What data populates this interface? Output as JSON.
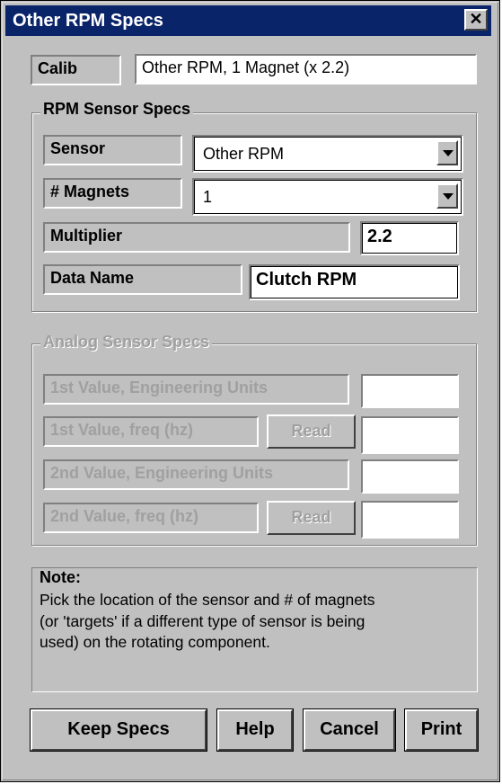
{
  "window": {
    "title": "Other RPM Specs",
    "close_symbol": "✕"
  },
  "calib": {
    "label": "Calib",
    "value": "Other RPM, 1 Magnet (x 2.2)"
  },
  "rpm_group": {
    "title": "RPM Sensor Specs",
    "sensor_label": "Sensor",
    "sensor_value": "Other RPM",
    "magnets_label": "# Magnets",
    "magnets_value": "1",
    "multiplier_label": "Multiplier",
    "multiplier_value": "2.2",
    "data_name_label": "Data Name",
    "data_name_value": "Clutch RPM"
  },
  "analog_group": {
    "title": "Analog Sensor Specs",
    "first_eng_label": "1st Value, Engineering Units",
    "first_freq_label": "1st Value, freq (hz)",
    "second_eng_label": "2nd Value, Engineering Units",
    "second_freq_label": "2nd Value, freq (hz)",
    "read_label": "Read",
    "first_eng_value": "",
    "first_freq_value": "",
    "second_eng_value": "",
    "second_freq_value": ""
  },
  "note": {
    "title": "Note:",
    "line1": "Pick the location of the sensor and # of magnets",
    "line2": "(or 'targets' if a different type of sensor is being",
    "line3": "used) on the rotating component."
  },
  "buttons": {
    "keep": "Keep Specs",
    "help": "Help",
    "cancel": "Cancel",
    "print": "Print"
  }
}
